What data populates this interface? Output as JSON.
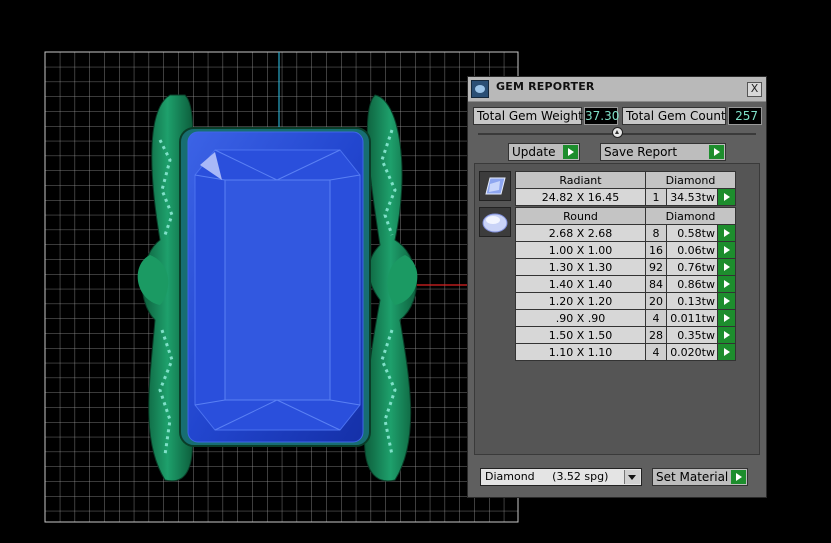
{
  "panel": {
    "title": "GEM REPORTER",
    "close_glyph": "X",
    "total_weight_label": "Total Gem Weight",
    "total_weight_value": "37.30",
    "total_count_label": "Total Gem Count",
    "total_count_value": "257",
    "update_label": "Update",
    "save_report_label": "Save Report",
    "material_select": "Diamond     (3.52 spg)",
    "set_material_label": "Set Material"
  },
  "groups": [
    {
      "shape": "Radiant",
      "icon": "radiant-gem-icon",
      "material": "Diamond",
      "rows": [
        {
          "size": "24.82 X 16.45",
          "count": "1",
          "weight": "34.53tw"
        }
      ]
    },
    {
      "shape": "Round",
      "icon": "round-gem-icon",
      "material": "Diamond",
      "rows": [
        {
          "size": "2.68 X 2.68",
          "count": "8",
          "weight": "0.58tw"
        },
        {
          "size": "1.00 X 1.00",
          "count": "16",
          "weight": "0.06tw"
        },
        {
          "size": "1.30 X 1.30",
          "count": "92",
          "weight": "0.76tw"
        },
        {
          "size": "1.40 X 1.40",
          "count": "84",
          "weight": "0.86tw"
        },
        {
          "size": "1.20 X 1.20",
          "count": "20",
          "weight": "0.13tw"
        },
        {
          "size": ".90 X .90",
          "count": "4",
          "weight": "0.011tw"
        },
        {
          "size": "1.50 X 1.50",
          "count": "28",
          "weight": "0.35tw"
        },
        {
          "size": "1.10 X 1.10",
          "count": "4",
          "weight": "0.020tw"
        }
      ]
    }
  ],
  "colors": {
    "background": "#000000",
    "grid": "#cfcfcf",
    "gem_blue": "#1f3fc8",
    "setting_green": "#16855a",
    "accent_cyan": "#7fe0c8",
    "play_green": "#1d8d2d"
  }
}
